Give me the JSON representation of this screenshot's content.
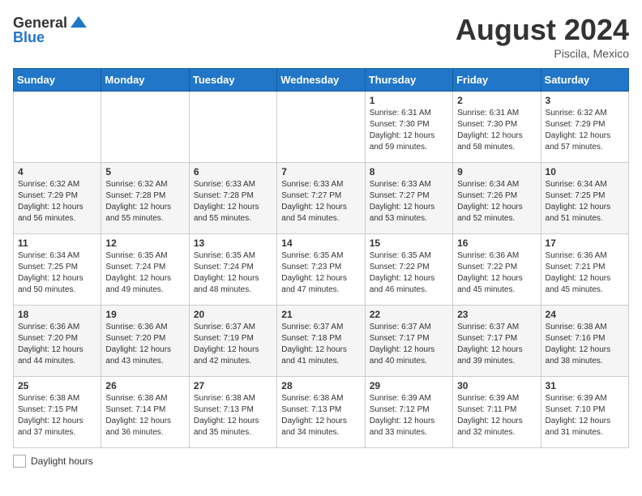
{
  "header": {
    "logo_general": "General",
    "logo_blue": "Blue",
    "month_year": "August 2024",
    "location": "Piscila, Mexico"
  },
  "days_of_week": [
    "Sunday",
    "Monday",
    "Tuesday",
    "Wednesday",
    "Thursday",
    "Friday",
    "Saturday"
  ],
  "legend_label": "Daylight hours",
  "weeks": [
    [
      {
        "day": "",
        "info": ""
      },
      {
        "day": "",
        "info": ""
      },
      {
        "day": "",
        "info": ""
      },
      {
        "day": "",
        "info": ""
      },
      {
        "day": "1",
        "info": "Sunrise: 6:31 AM\nSunset: 7:30 PM\nDaylight: 12 hours and 59 minutes."
      },
      {
        "day": "2",
        "info": "Sunrise: 6:31 AM\nSunset: 7:30 PM\nDaylight: 12 hours and 58 minutes."
      },
      {
        "day": "3",
        "info": "Sunrise: 6:32 AM\nSunset: 7:29 PM\nDaylight: 12 hours and 57 minutes."
      }
    ],
    [
      {
        "day": "4",
        "info": "Sunrise: 6:32 AM\nSunset: 7:29 PM\nDaylight: 12 hours and 56 minutes."
      },
      {
        "day": "5",
        "info": "Sunrise: 6:32 AM\nSunset: 7:28 PM\nDaylight: 12 hours and 55 minutes."
      },
      {
        "day": "6",
        "info": "Sunrise: 6:33 AM\nSunset: 7:28 PM\nDaylight: 12 hours and 55 minutes."
      },
      {
        "day": "7",
        "info": "Sunrise: 6:33 AM\nSunset: 7:27 PM\nDaylight: 12 hours and 54 minutes."
      },
      {
        "day": "8",
        "info": "Sunrise: 6:33 AM\nSunset: 7:27 PM\nDaylight: 12 hours and 53 minutes."
      },
      {
        "day": "9",
        "info": "Sunrise: 6:34 AM\nSunset: 7:26 PM\nDaylight: 12 hours and 52 minutes."
      },
      {
        "day": "10",
        "info": "Sunrise: 6:34 AM\nSunset: 7:25 PM\nDaylight: 12 hours and 51 minutes."
      }
    ],
    [
      {
        "day": "11",
        "info": "Sunrise: 6:34 AM\nSunset: 7:25 PM\nDaylight: 12 hours and 50 minutes."
      },
      {
        "day": "12",
        "info": "Sunrise: 6:35 AM\nSunset: 7:24 PM\nDaylight: 12 hours and 49 minutes."
      },
      {
        "day": "13",
        "info": "Sunrise: 6:35 AM\nSunset: 7:24 PM\nDaylight: 12 hours and 48 minutes."
      },
      {
        "day": "14",
        "info": "Sunrise: 6:35 AM\nSunset: 7:23 PM\nDaylight: 12 hours and 47 minutes."
      },
      {
        "day": "15",
        "info": "Sunrise: 6:35 AM\nSunset: 7:22 PM\nDaylight: 12 hours and 46 minutes."
      },
      {
        "day": "16",
        "info": "Sunrise: 6:36 AM\nSunset: 7:22 PM\nDaylight: 12 hours and 45 minutes."
      },
      {
        "day": "17",
        "info": "Sunrise: 6:36 AM\nSunset: 7:21 PM\nDaylight: 12 hours and 45 minutes."
      }
    ],
    [
      {
        "day": "18",
        "info": "Sunrise: 6:36 AM\nSunset: 7:20 PM\nDaylight: 12 hours and 44 minutes."
      },
      {
        "day": "19",
        "info": "Sunrise: 6:36 AM\nSunset: 7:20 PM\nDaylight: 12 hours and 43 minutes."
      },
      {
        "day": "20",
        "info": "Sunrise: 6:37 AM\nSunset: 7:19 PM\nDaylight: 12 hours and 42 minutes."
      },
      {
        "day": "21",
        "info": "Sunrise: 6:37 AM\nSunset: 7:18 PM\nDaylight: 12 hours and 41 minutes."
      },
      {
        "day": "22",
        "info": "Sunrise: 6:37 AM\nSunset: 7:17 PM\nDaylight: 12 hours and 40 minutes."
      },
      {
        "day": "23",
        "info": "Sunrise: 6:37 AM\nSunset: 7:17 PM\nDaylight: 12 hours and 39 minutes."
      },
      {
        "day": "24",
        "info": "Sunrise: 6:38 AM\nSunset: 7:16 PM\nDaylight: 12 hours and 38 minutes."
      }
    ],
    [
      {
        "day": "25",
        "info": "Sunrise: 6:38 AM\nSunset: 7:15 PM\nDaylight: 12 hours and 37 minutes."
      },
      {
        "day": "26",
        "info": "Sunrise: 6:38 AM\nSunset: 7:14 PM\nDaylight: 12 hours and 36 minutes."
      },
      {
        "day": "27",
        "info": "Sunrise: 6:38 AM\nSunset: 7:13 PM\nDaylight: 12 hours and 35 minutes."
      },
      {
        "day": "28",
        "info": "Sunrise: 6:38 AM\nSunset: 7:13 PM\nDaylight: 12 hours and 34 minutes."
      },
      {
        "day": "29",
        "info": "Sunrise: 6:39 AM\nSunset: 7:12 PM\nDaylight: 12 hours and 33 minutes."
      },
      {
        "day": "30",
        "info": "Sunrise: 6:39 AM\nSunset: 7:11 PM\nDaylight: 12 hours and 32 minutes."
      },
      {
        "day": "31",
        "info": "Sunrise: 6:39 AM\nSunset: 7:10 PM\nDaylight: 12 hours and 31 minutes."
      }
    ]
  ]
}
